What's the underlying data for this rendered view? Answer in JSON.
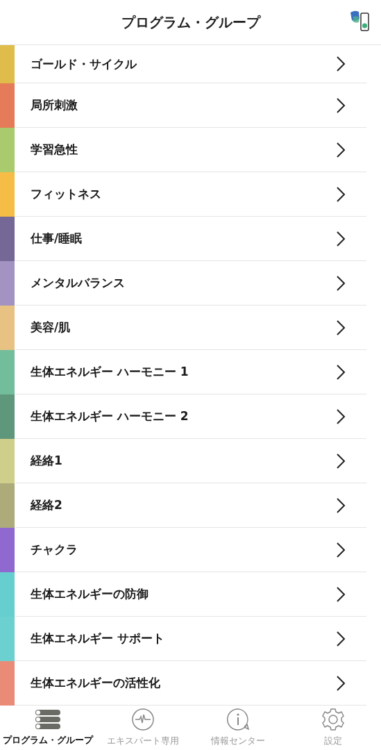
{
  "header": {
    "title": "プログラム・グループ"
  },
  "groups": [
    {
      "label": "ゴールド・サイクル",
      "color": "#e0bd4a"
    },
    {
      "label": "局所刺激",
      "color": "#e57b58"
    },
    {
      "label": "学習急性",
      "color": "#a9cb6e"
    },
    {
      "label": "フィットネス",
      "color": "#f5bd45"
    },
    {
      "label": "仕事/睡眠",
      "color": "#766896"
    },
    {
      "label": "メンタルバランス",
      "color": "#a393c2"
    },
    {
      "label": "美容/肌",
      "color": "#e8c283"
    },
    {
      "label": "生体エネルギー ハーモニー 1",
      "color": "#72be9c"
    },
    {
      "label": "生体エネルギー ハーモニー 2",
      "color": "#5e977c"
    },
    {
      "label": "経絡1",
      "color": "#cfcf8b"
    },
    {
      "label": "経絡2",
      "color": "#adab7a"
    },
    {
      "label": "チャクラ",
      "color": "#8f68d0"
    },
    {
      "label": "生体エネルギーの防御",
      "color": "#66cece"
    },
    {
      "label": "生体エネルギー サポート",
      "color": "#6cd0d0"
    },
    {
      "label": "生体エネルギーの活性化",
      "color": "#ea8b78"
    }
  ],
  "tabs": [
    {
      "label": "プログラム・グループ",
      "kind": "list",
      "selected": true
    },
    {
      "label": "エキスパート専用",
      "kind": "pulse",
      "selected": false
    },
    {
      "label": "情報センター",
      "kind": "info",
      "selected": false
    },
    {
      "label": "設定",
      "kind": "gear",
      "selected": false
    }
  ]
}
